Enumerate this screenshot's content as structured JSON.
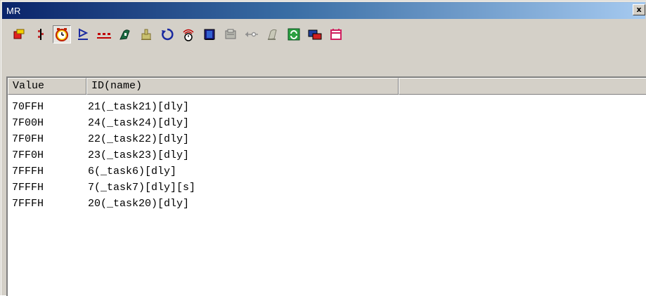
{
  "window": {
    "title": "MR",
    "close_glyph": "x"
  },
  "toolbar": {
    "buttons": [
      {
        "icon": "task-state-icon",
        "pressed": false
      },
      {
        "icon": "ready-queue-icon",
        "pressed": false
      },
      {
        "icon": "timeout-queue-icon",
        "pressed": true
      },
      {
        "icon": "event-flag-icon",
        "pressed": false
      },
      {
        "icon": "semaphore-icon",
        "pressed": false
      },
      {
        "icon": "mailbox-icon",
        "pressed": false
      },
      {
        "icon": "data-queue-icon",
        "pressed": false
      },
      {
        "icon": "cyclic-handler-icon",
        "pressed": false
      },
      {
        "icon": "alarm-handler-icon",
        "pressed": false
      },
      {
        "icon": "memory-pool-icon",
        "pressed": false
      },
      {
        "icon": "message-buffer-icon",
        "pressed": false
      },
      {
        "icon": "port-icon",
        "pressed": false
      },
      {
        "icon": "variable-pool-icon",
        "pressed": false
      },
      {
        "icon": "refresh-icon",
        "pressed": false
      },
      {
        "icon": "task-context-icon",
        "pressed": false
      },
      {
        "icon": "exit-icon",
        "pressed": false
      }
    ]
  },
  "list": {
    "columns": [
      "Value",
      "ID(name)",
      ""
    ],
    "rows": [
      {
        "value": "70FFH",
        "id": "21(_task21)[dly]"
      },
      {
        "value": "7F00H",
        "id": "24(_task24)[dly]"
      },
      {
        "value": "7F0FH",
        "id": "22(_task22)[dly]"
      },
      {
        "value": "7FF0H",
        "id": "23(_task23)[dly]"
      },
      {
        "value": "7FFFH",
        "id": "6(_task6)[dly]"
      },
      {
        "value": "7FFFH",
        "id": "7(_task7)[dly][s]"
      },
      {
        "value": "7FFFH",
        "id": "20(_task20)[dly]"
      }
    ]
  },
  "colors": {
    "title_start": "#0a246a",
    "title_end": "#a6caf0",
    "face": "#d4d0c8"
  }
}
